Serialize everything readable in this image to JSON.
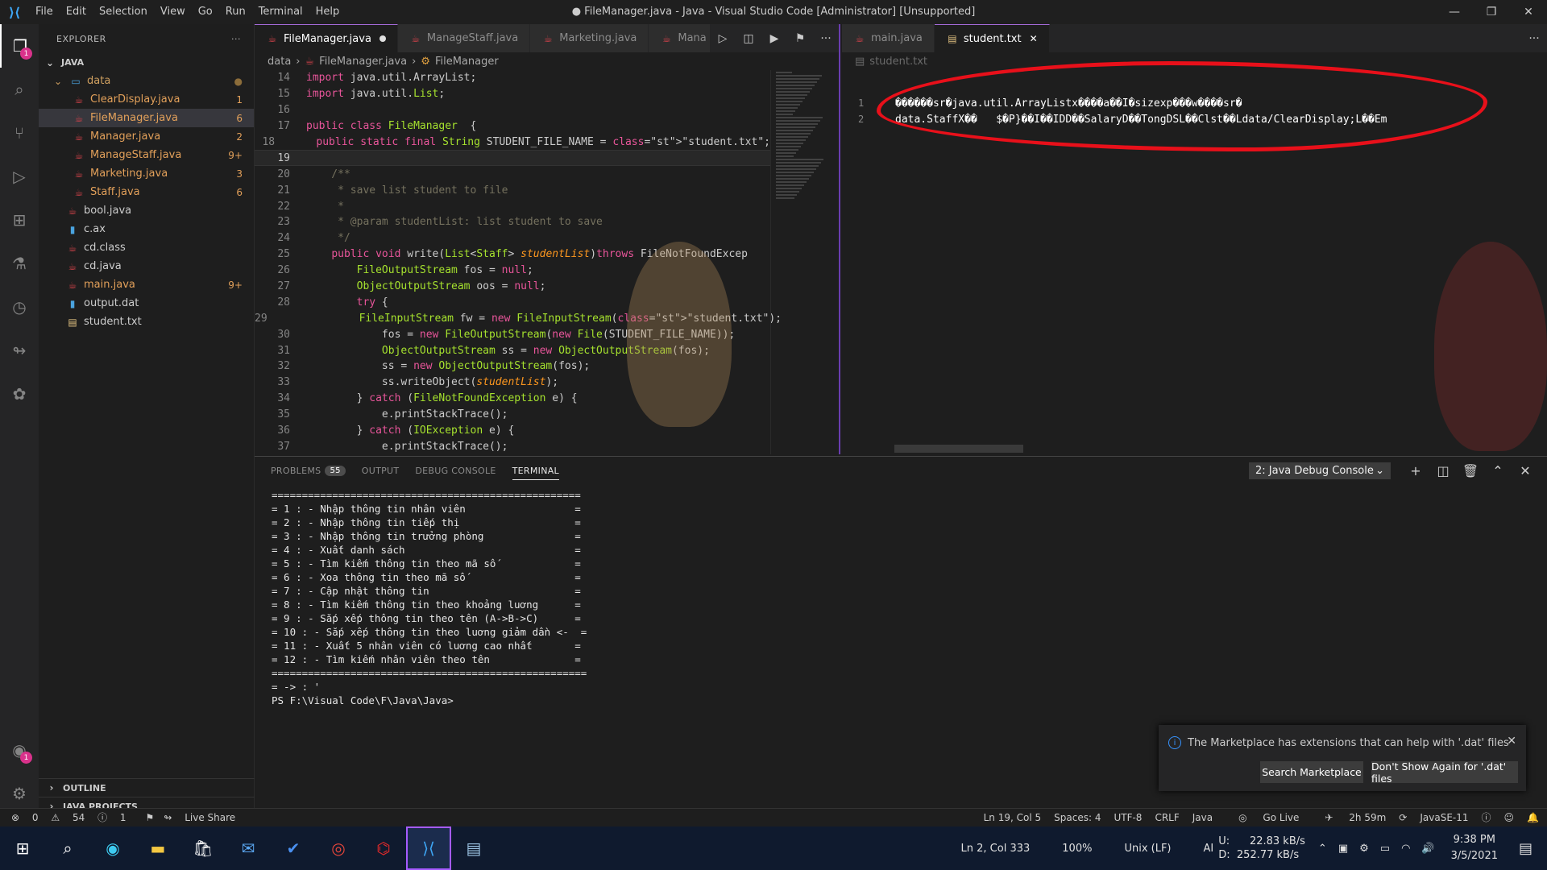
{
  "titlebar": {
    "menu": [
      "File",
      "Edit",
      "Selection",
      "View",
      "Go",
      "Run",
      "Terminal",
      "Help"
    ],
    "title": "● FileManager.java - Java - Visual Studio Code [Administrator] [Unsupported]"
  },
  "activity": {
    "explorer_badge": "1",
    "account_badge": "1"
  },
  "sidebar": {
    "header": "EXPLORER",
    "root": "JAVA",
    "folder": "data",
    "data_files": [
      {
        "name": "ClearDisplay.java",
        "badge": "1"
      },
      {
        "name": "FileManager.java",
        "badge": "6"
      },
      {
        "name": "Manager.java",
        "badge": "2"
      },
      {
        "name": "ManageStaff.java",
        "badge": "9+"
      },
      {
        "name": "Marketing.java",
        "badge": "3"
      },
      {
        "name": "Staff.java",
        "badge": "6"
      }
    ],
    "files": [
      {
        "name": "bool.java",
        "badge": ""
      },
      {
        "name": "c.ax",
        "badge": ""
      },
      {
        "name": "cd.class",
        "badge": ""
      },
      {
        "name": "cd.java",
        "badge": ""
      },
      {
        "name": "main.java",
        "badge": "9+"
      },
      {
        "name": "output.dat",
        "badge": ""
      },
      {
        "name": "student.txt",
        "badge": ""
      }
    ],
    "outline": "OUTLINE",
    "java_projects": "JAVA PROJECTS"
  },
  "editor1": {
    "tabs": [
      "FileManager.java",
      "ManageStaff.java",
      "Marketing.java",
      "Mana"
    ],
    "breadcrumb": [
      "data",
      "FileManager.java",
      "FileManager"
    ],
    "lines": [
      {
        "n": "14",
        "t": "import java.util.ArrayList;"
      },
      {
        "n": "15",
        "t": "import java.util.List;"
      },
      {
        "n": "16",
        "t": ""
      },
      {
        "n": "17",
        "t": "public class FileManager  {"
      },
      {
        "n": "18",
        "t": "    public static final String STUDENT_FILE_NAME = \"student.txt\";"
      },
      {
        "n": "19",
        "t": "    "
      },
      {
        "n": "20",
        "t": "    /**"
      },
      {
        "n": "21",
        "t": "     * save list student to file"
      },
      {
        "n": "22",
        "t": "     *"
      },
      {
        "n": "23",
        "t": "     * @param studentList: list student to save"
      },
      {
        "n": "24",
        "t": "     */"
      },
      {
        "n": "25",
        "t": "    public void write(List<Staff> studentList)throws FileNotFoundExcep"
      },
      {
        "n": "26",
        "t": "        FileOutputStream fos = null;"
      },
      {
        "n": "27",
        "t": "        ObjectOutputStream oos = null;"
      },
      {
        "n": "28",
        "t": "        try {"
      },
      {
        "n": "29",
        "t": "            FileInputStream fw = new FileInputStream(\"student.txt\");"
      },
      {
        "n": "30",
        "t": "            fos = new FileOutputStream(new File(STUDENT_FILE_NAME));"
      },
      {
        "n": "31",
        "t": "            ObjectOutputStream ss = new ObjectOutputStream(fos);"
      },
      {
        "n": "32",
        "t": "            ss = new ObjectOutputStream(fos);"
      },
      {
        "n": "33",
        "t": "            ss.writeObject(studentList);"
      },
      {
        "n": "34",
        "t": "        } catch (FileNotFoundException e) {"
      },
      {
        "n": "35",
        "t": "            e.printStackTrace();"
      },
      {
        "n": "36",
        "t": "        } catch (IOException e) {"
      },
      {
        "n": "37",
        "t": "            e.printStackTrace();"
      }
    ]
  },
  "editor2": {
    "tabs": [
      "main.java",
      "student.txt"
    ],
    "breadcrumb": "student.txt",
    "lines": [
      {
        "n": "1",
        "t": "������sr�java.util.ArrayListx����a��I�sizexp���w����sr�"
      },
      {
        "n": "2",
        "t": "data.StaffX��   $�P}��I��IDD��SalaryD��TongDSL��Clst��Ldata/ClearDisplay;L��Em"
      }
    ]
  },
  "panel": {
    "tabs": [
      "PROBLEMS",
      "OUTPUT",
      "DEBUG CONSOLE",
      "TERMINAL"
    ],
    "problems_count": "55",
    "console_select": "2: Java Debug Console",
    "terminal": [
      "===================================================",
      "= 1 : - Nhập thông tin nhân viên                  =",
      "= 2 : - Nhập thông tin tiếp thị                   =",
      "= 3 : - Nhập thông tin trưởng phòng               =",
      "= 4 : - Xuất danh sách                            =",
      "= 5 : - Tìm kiếm thông tin theo mã số             =",
      "= 6 : - Xoa thông tin theo mã số                  =",
      "= 7 : - Cập nhật thông tin                        =",
      "= 8 : - Tìm kiếm thông tin theo khoảng luơng      =",
      "= 9 : - Sắp xếp thông tin theo tên (A->B->C)      =",
      "= 10 : - Sắp xếp thông tin theo luơng giảm dần <-  =",
      "= 11 : - Xuất 5 nhân viên có luơng cao nhất       =",
      "= 12 : - Tìm kiếm nhân viên theo tên              =",
      "====================================================",
      "= -> : '",
      "PS F:\\Visual Code\\F\\Java\\Java> "
    ]
  },
  "notification": {
    "message": "The Marketplace has extensions that can help with '.dat' files",
    "btn_search": "Search Marketplace",
    "btn_dont_show": "Don't Show Again for '.dat' files"
  },
  "status": {
    "errors": "0",
    "warnings": "54",
    "info": "1",
    "live_share": "Live Share",
    "position": "Ln 19, Col 5",
    "spaces": "Spaces: 4",
    "encoding": "UTF-8",
    "eol": "CRLF",
    "language": "Java",
    "go_live": "Go Live",
    "time_spent": "2h 59m",
    "jdk": "JavaSE-11"
  },
  "taskbar": {
    "notepad_pos": "Ln 2, Col 333",
    "zoom": "100%",
    "eol": "Unix (LF)",
    "ai": "AI",
    "upload_label": "U:",
    "upload": "22.83 kB/s",
    "download_label": "D:",
    "download": "252.77 kB/s",
    "time": "9:38 PM",
    "date": "3/5/2021"
  }
}
